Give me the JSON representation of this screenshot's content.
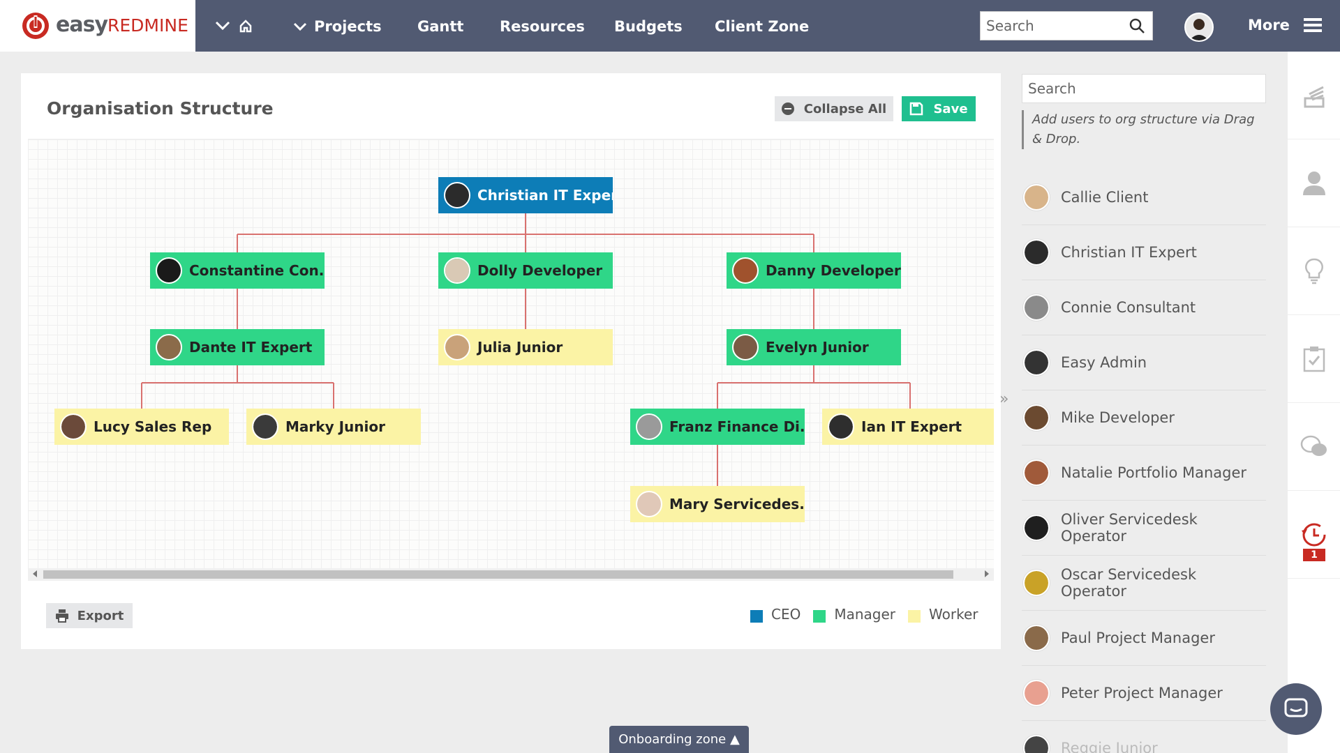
{
  "app": {
    "logo_word": "easy",
    "logo_brand": "REDMINE"
  },
  "topnav": {
    "items": [
      {
        "label": "Projects"
      },
      {
        "label": "Gantt"
      },
      {
        "label": "Resources"
      },
      {
        "label": "Budgets"
      },
      {
        "label": "Client Zone"
      }
    ],
    "search_placeholder": "Search",
    "more_label": "More"
  },
  "panel": {
    "title": "Organisation Structure",
    "collapse_label": "Collapse All",
    "save_label": "Save",
    "export_label": "Export"
  },
  "org": {
    "nodes": [
      {
        "name": "Christian IT Expert",
        "role": "ceo",
        "avatar": "#2b2b2b"
      },
      {
        "name": "Constantine Con...",
        "role": "manager",
        "avatar": "#1a1a1a"
      },
      {
        "name": "Dolly Developer",
        "role": "manager",
        "avatar": "#d9c9b5"
      },
      {
        "name": "Danny Developer",
        "role": "manager",
        "avatar": "#a0522d"
      },
      {
        "name": "Dante IT Expert",
        "role": "manager",
        "avatar": "#8b6b4a"
      },
      {
        "name": "Julia Junior",
        "role": "worker",
        "avatar": "#c9a27a"
      },
      {
        "name": "Evelyn Junior",
        "role": "manager",
        "avatar": "#7b5b45"
      },
      {
        "name": "Lucy Sales Rep",
        "role": "worker",
        "avatar": "#6b4a3a"
      },
      {
        "name": "Marky Junior",
        "role": "worker",
        "avatar": "#3a3a3a"
      },
      {
        "name": "Franz Finance Di...",
        "role": "manager",
        "avatar": "#9a9a9a"
      },
      {
        "name": "Ian IT Expert",
        "role": "worker",
        "avatar": "#2e2e2e"
      },
      {
        "name": "Mary Servicedes...",
        "role": "worker",
        "avatar": "#e0c8b8"
      }
    ]
  },
  "legend": [
    {
      "label": "CEO",
      "color": "#0d7db7"
    },
    {
      "label": "Manager",
      "color": "#2fd688"
    },
    {
      "label": "Worker",
      "color": "#fbf3a5"
    }
  ],
  "sidebar": {
    "search_placeholder": "Search",
    "hint": "Add users to org structure via Drag & Drop.",
    "users": [
      {
        "name": "Callie Client",
        "avatar": "#d8b48a"
      },
      {
        "name": "Christian IT Expert",
        "avatar": "#2b2b2b"
      },
      {
        "name": "Connie Consultant",
        "avatar": "#8a8a8a"
      },
      {
        "name": "Easy Admin",
        "avatar": "#333333"
      },
      {
        "name": "Mike Developer",
        "avatar": "#6b4a30"
      },
      {
        "name": "Natalie Portfolio Manager",
        "avatar": "#a05a3a"
      },
      {
        "name": "Oliver Servicedesk Operator",
        "avatar": "#1f1f1f"
      },
      {
        "name": "Oscar Servicedesk Operator",
        "avatar": "#c9a227"
      },
      {
        "name": "Paul Project Manager",
        "avatar": "#8a6a4a"
      },
      {
        "name": "Peter Project Manager",
        "avatar": "#e8a090"
      },
      {
        "name": "Reggie Junior",
        "avatar": "#444444"
      }
    ]
  },
  "rail": {
    "badge_count": "1"
  },
  "footer": {
    "onboarding_label": "Onboarding zone ▲"
  }
}
